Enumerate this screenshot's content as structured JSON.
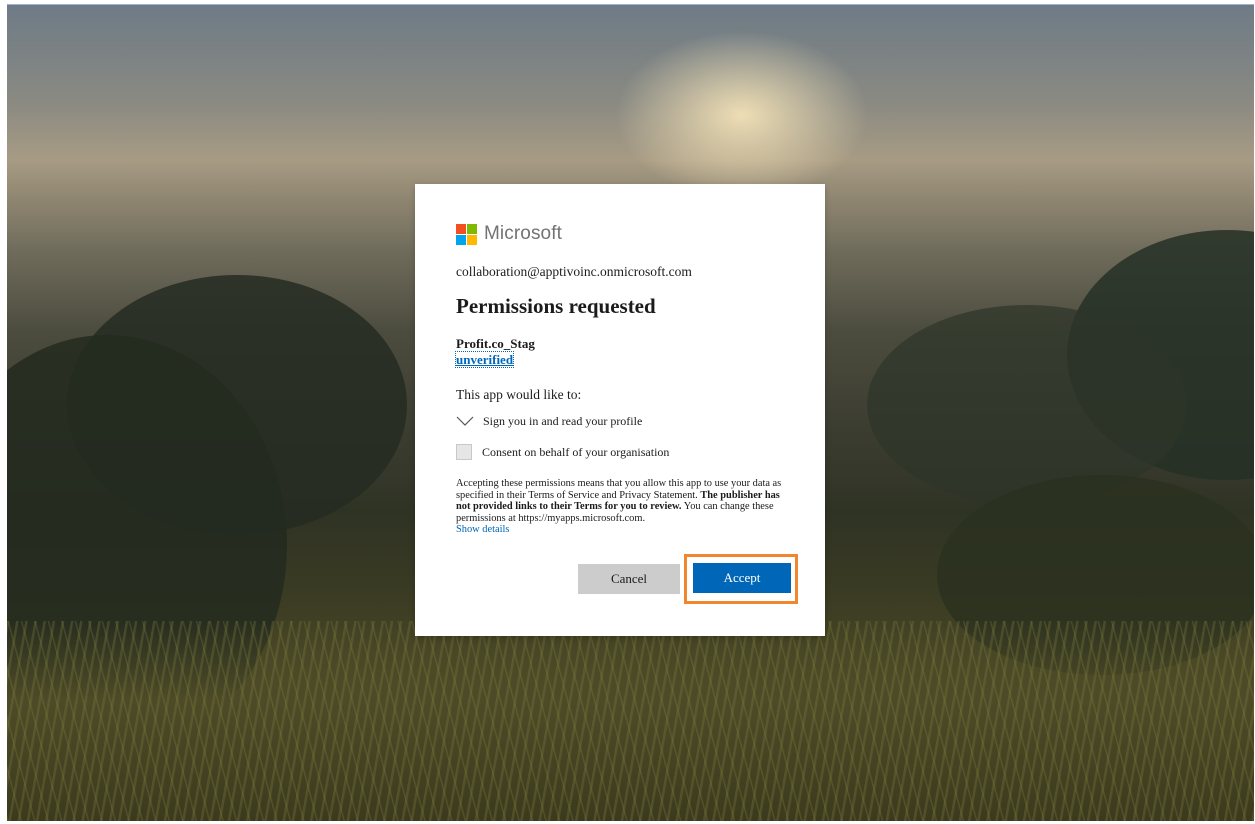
{
  "brand": {
    "name": "Microsoft",
    "logo_colors": [
      "#f25022",
      "#7fba00",
      "#00a4ef",
      "#ffb900"
    ]
  },
  "account": "collaboration@apptivoinc.onmicrosoft.com",
  "title": "Permissions requested",
  "app": {
    "name": "Profit.co_Stag",
    "status": "unverified"
  },
  "intro": "This app would like to:",
  "permissions": [
    {
      "label": "Sign you in and read your profile",
      "icon": "chevron-down-icon"
    },
    {
      "label": "Consent on behalf of your organisation",
      "icon": "checkbox",
      "checked": false
    }
  ],
  "disclaimer": {
    "part1": "Accepting these permissions means that you allow this app to use your data as specified in their Terms of Service and Privacy Statement. ",
    "bold": "The publisher has not provided links to their Terms for you to review.",
    "part2": " You can change these permissions at https://myapps.microsoft.com."
  },
  "show_details": "Show details",
  "buttons": {
    "cancel": "Cancel",
    "accept": "Accept"
  },
  "colors": {
    "accent": "#0067b8",
    "highlight": "#f0862e"
  }
}
